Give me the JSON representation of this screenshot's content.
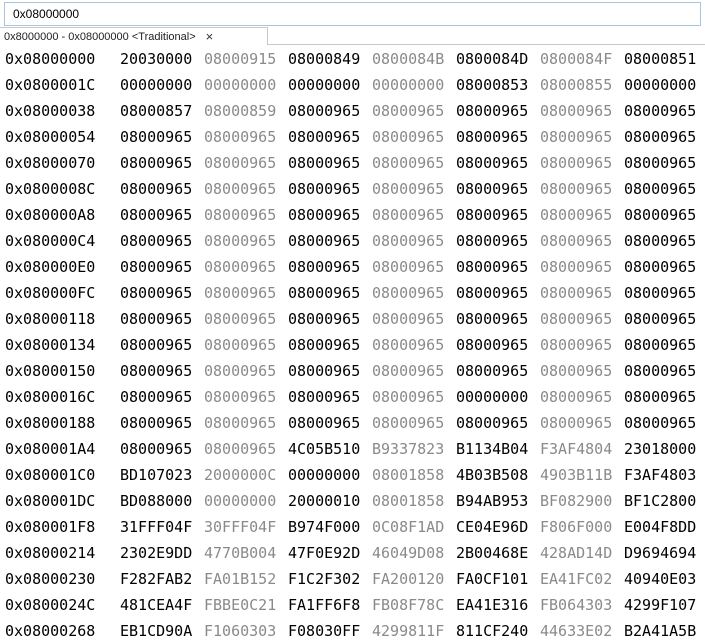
{
  "address_bar": {
    "value": "0x08000000"
  },
  "tab": {
    "label": "0x8000000 - 0x08000000 <Traditional>",
    "close_glyph": "×"
  },
  "memory": {
    "rows": [
      {
        "addr": "0x08000000",
        "words": [
          "20030000",
          "08000915",
          "08000849",
          "0800084B",
          "0800084D",
          "0800084F",
          "08000851"
        ]
      },
      {
        "addr": "0x0800001C",
        "words": [
          "00000000",
          "00000000",
          "00000000",
          "00000000",
          "08000853",
          "08000855",
          "00000000"
        ]
      },
      {
        "addr": "0x08000038",
        "words": [
          "08000857",
          "08000859",
          "08000965",
          "08000965",
          "08000965",
          "08000965",
          "08000965"
        ]
      },
      {
        "addr": "0x08000054",
        "words": [
          "08000965",
          "08000965",
          "08000965",
          "08000965",
          "08000965",
          "08000965",
          "08000965"
        ]
      },
      {
        "addr": "0x08000070",
        "words": [
          "08000965",
          "08000965",
          "08000965",
          "08000965",
          "08000965",
          "08000965",
          "08000965"
        ]
      },
      {
        "addr": "0x0800008C",
        "words": [
          "08000965",
          "08000965",
          "08000965",
          "08000965",
          "08000965",
          "08000965",
          "08000965"
        ]
      },
      {
        "addr": "0x080000A8",
        "words": [
          "08000965",
          "08000965",
          "08000965",
          "08000965",
          "08000965",
          "08000965",
          "08000965"
        ]
      },
      {
        "addr": "0x080000C4",
        "words": [
          "08000965",
          "08000965",
          "08000965",
          "08000965",
          "08000965",
          "08000965",
          "08000965"
        ]
      },
      {
        "addr": "0x080000E0",
        "words": [
          "08000965",
          "08000965",
          "08000965",
          "08000965",
          "08000965",
          "08000965",
          "08000965"
        ]
      },
      {
        "addr": "0x080000FC",
        "words": [
          "08000965",
          "08000965",
          "08000965",
          "08000965",
          "08000965",
          "08000965",
          "08000965"
        ]
      },
      {
        "addr": "0x08000118",
        "words": [
          "08000965",
          "08000965",
          "08000965",
          "08000965",
          "08000965",
          "08000965",
          "08000965"
        ]
      },
      {
        "addr": "0x08000134",
        "words": [
          "08000965",
          "08000965",
          "08000965",
          "08000965",
          "08000965",
          "08000965",
          "08000965"
        ]
      },
      {
        "addr": "0x08000150",
        "words": [
          "08000965",
          "08000965",
          "08000965",
          "08000965",
          "08000965",
          "08000965",
          "08000965"
        ]
      },
      {
        "addr": "0x0800016C",
        "words": [
          "08000965",
          "08000965",
          "08000965",
          "08000965",
          "00000000",
          "08000965",
          "08000965"
        ]
      },
      {
        "addr": "0x08000188",
        "words": [
          "08000965",
          "08000965",
          "08000965",
          "08000965",
          "08000965",
          "08000965",
          "08000965"
        ]
      },
      {
        "addr": "0x080001A4",
        "words": [
          "08000965",
          "08000965",
          "4C05B510",
          "B9337823",
          "B1134B04",
          "F3AF4804",
          "23018000"
        ]
      },
      {
        "addr": "0x080001C0",
        "words": [
          "BD107023",
          "2000000C",
          "00000000",
          "08001858",
          "4B03B508",
          "4903B11B",
          "F3AF4803"
        ]
      },
      {
        "addr": "0x080001DC",
        "words": [
          "BD088000",
          "00000000",
          "20000010",
          "08001858",
          "B94AB953",
          "BF082900",
          "BF1C2800"
        ]
      },
      {
        "addr": "0x080001F8",
        "words": [
          "31FFF04F",
          "30FFF04F",
          "B974F000",
          "0C08F1AD",
          "CE04E96D",
          "F806F000",
          "E004F8DD"
        ]
      },
      {
        "addr": "0x08000214",
        "words": [
          "2302E9DD",
          "4770B004",
          "47F0E92D",
          "46049D08",
          "2B00468E",
          "428AD14D",
          "D9694694"
        ]
      },
      {
        "addr": "0x08000230",
        "words": [
          "F282FAB2",
          "FA01B152",
          "F1C2F302",
          "FA200120",
          "FA0CF101",
          "EA41FC02",
          "40940E03"
        ]
      },
      {
        "addr": "0x0800024C",
        "words": [
          "481CEA4F",
          "FBBE0C21",
          "FA1FF6F8",
          "FB08F78C",
          "EA41E316",
          "FB064303",
          "4299F107"
        ]
      },
      {
        "addr": "0x08000268",
        "words": [
          "EB1CD90A",
          "F1060303",
          "F08030FF",
          "4299811F",
          "811CF240",
          "44633E02",
          "B2A41A5B"
        ]
      }
    ]
  }
}
